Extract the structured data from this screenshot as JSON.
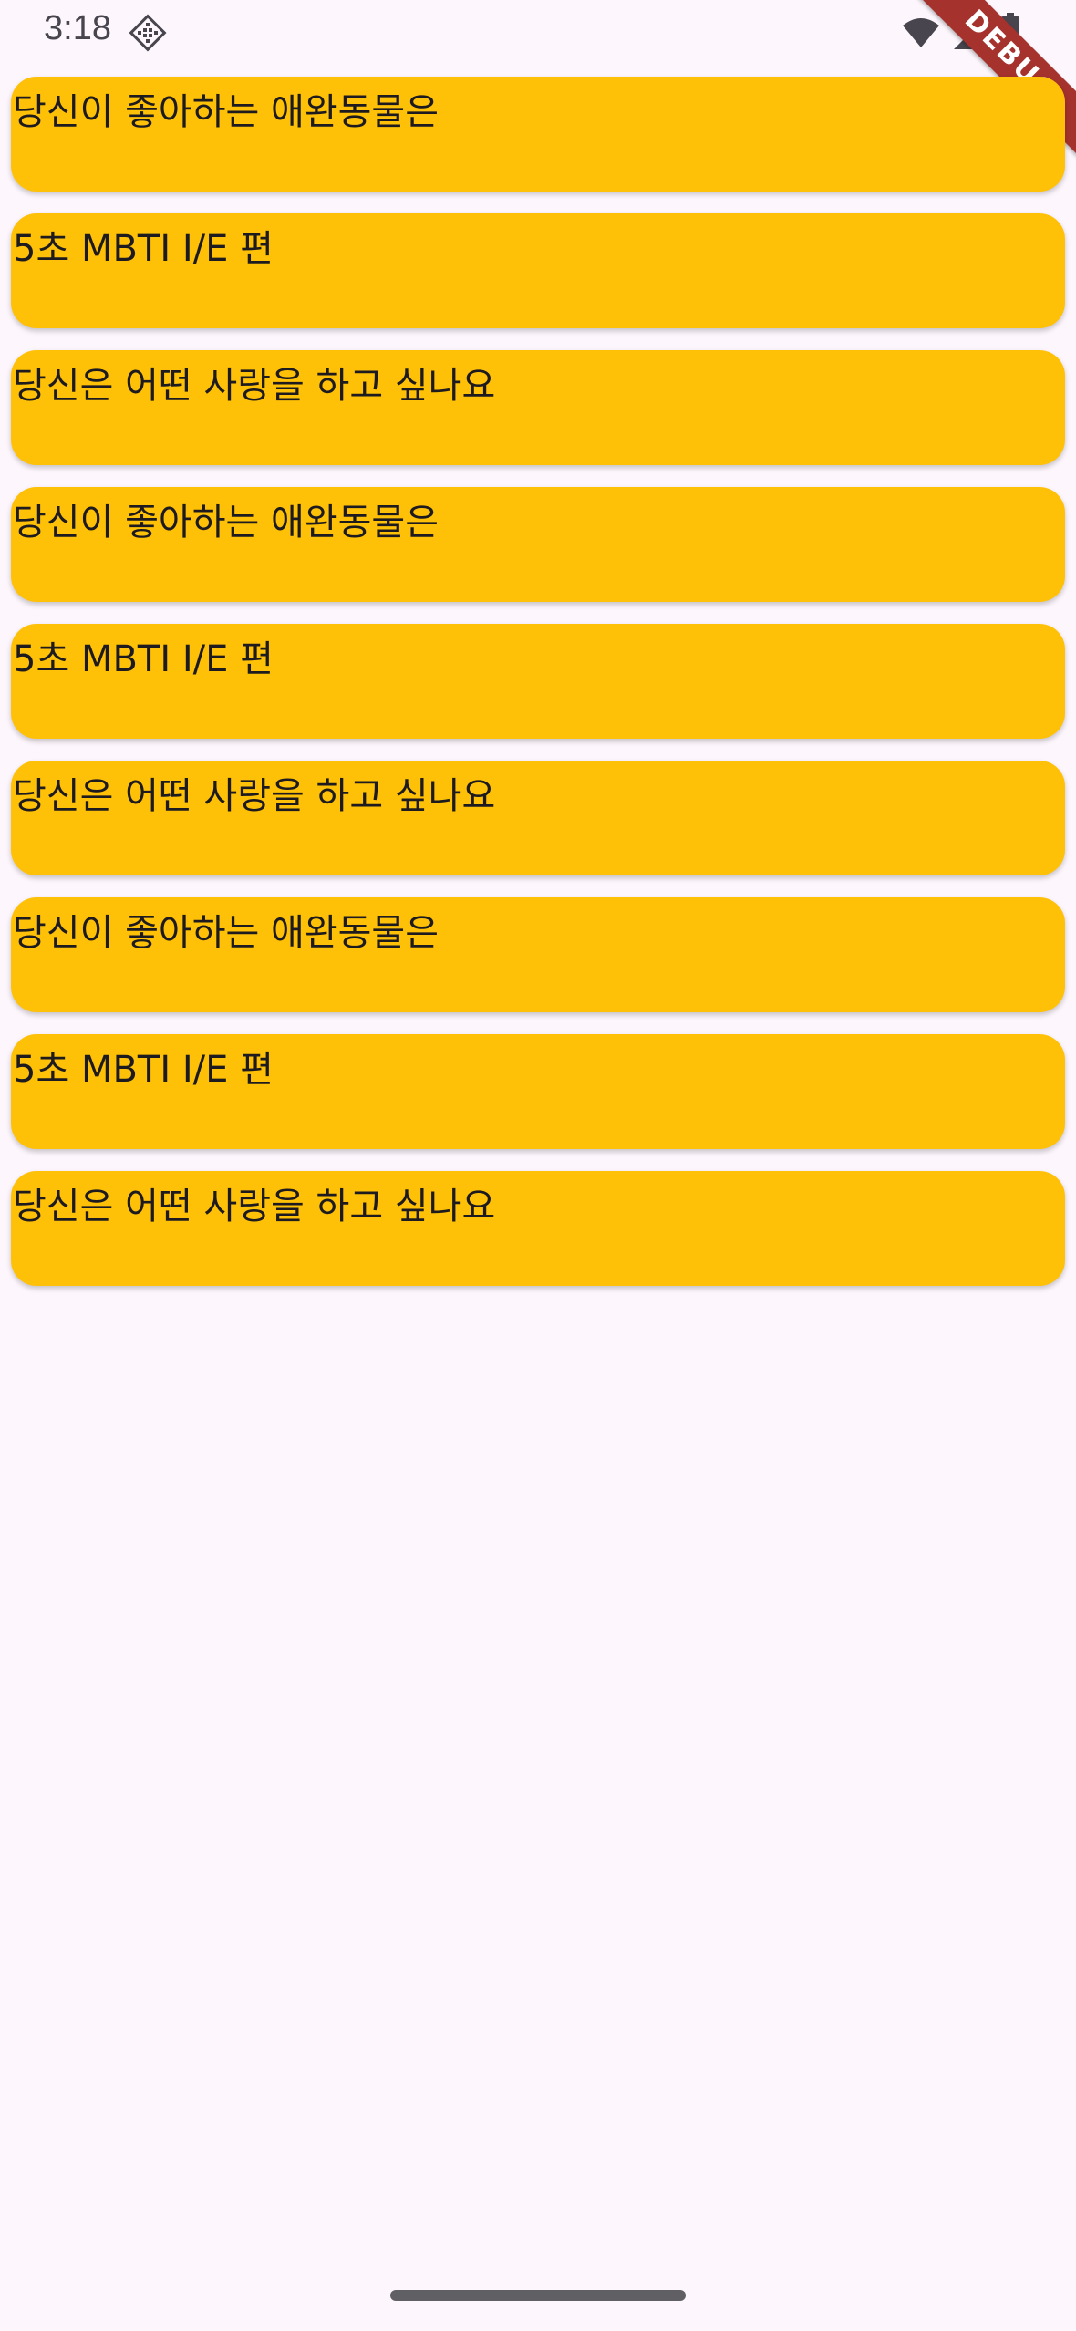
{
  "status_bar": {
    "time": "3:18",
    "app_icon": "android-studio-diamond-icon",
    "wifi_icon": "wifi-icon",
    "signal_icon": "cellular-signal-icon",
    "battery_icon": "battery-icon"
  },
  "debug_banner": {
    "label": "DEBUG",
    "color": "#a5322d"
  },
  "cards": [
    {
      "title": "당신이 좋아하는 애완동물은"
    },
    {
      "title": "5초 MBTI I/E 편"
    },
    {
      "title": "당신은 어떤 사랑을 하고 싶나요"
    },
    {
      "title": "당신이 좋아하는 애완동물은"
    },
    {
      "title": "5초 MBTI I/E 편"
    },
    {
      "title": "당신은 어떤 사랑을 하고 싶나요"
    },
    {
      "title": "당신이 좋아하는 애완동물은"
    },
    {
      "title": "5초 MBTI I/E 편"
    },
    {
      "title": "당신은 어떤 사랑을 하고 싶나요"
    }
  ],
  "colors": {
    "background": "#fdf7fd",
    "card": "#ffc107",
    "text": "#1d1b20"
  }
}
